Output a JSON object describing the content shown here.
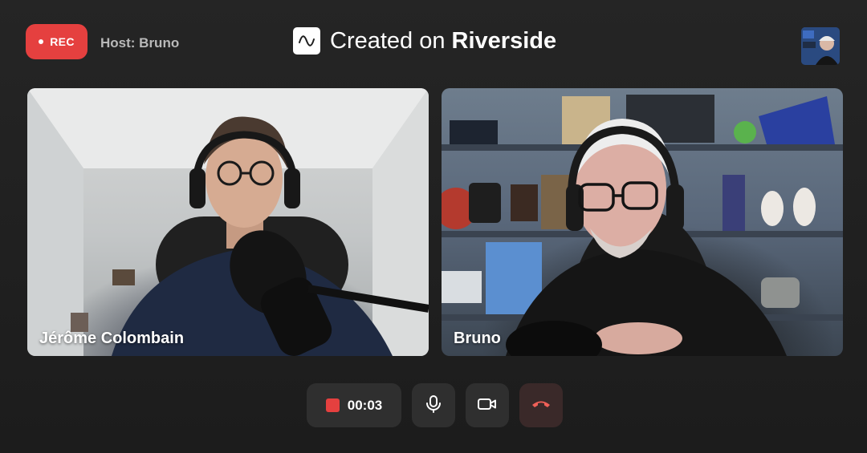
{
  "recording": {
    "label": "REC"
  },
  "host": {
    "label": "Host: Bruno"
  },
  "brand": {
    "prefix": "Created on ",
    "name": "Riverside"
  },
  "participants": [
    {
      "name": "Jérôme Colombain"
    },
    {
      "name": "Bruno"
    }
  ],
  "controls": {
    "timer": "00:03"
  },
  "colors": {
    "accent_red": "#e5403f",
    "background": "#1d1d1d",
    "control_bg": "#2f2f2f",
    "end_call_bg": "#3a2929"
  },
  "icons": {
    "brand": "wave-logo-icon",
    "mic": "microphone-icon",
    "camera": "camera-icon",
    "end_call": "phone-hangup-icon",
    "stop": "stop-square-icon"
  }
}
